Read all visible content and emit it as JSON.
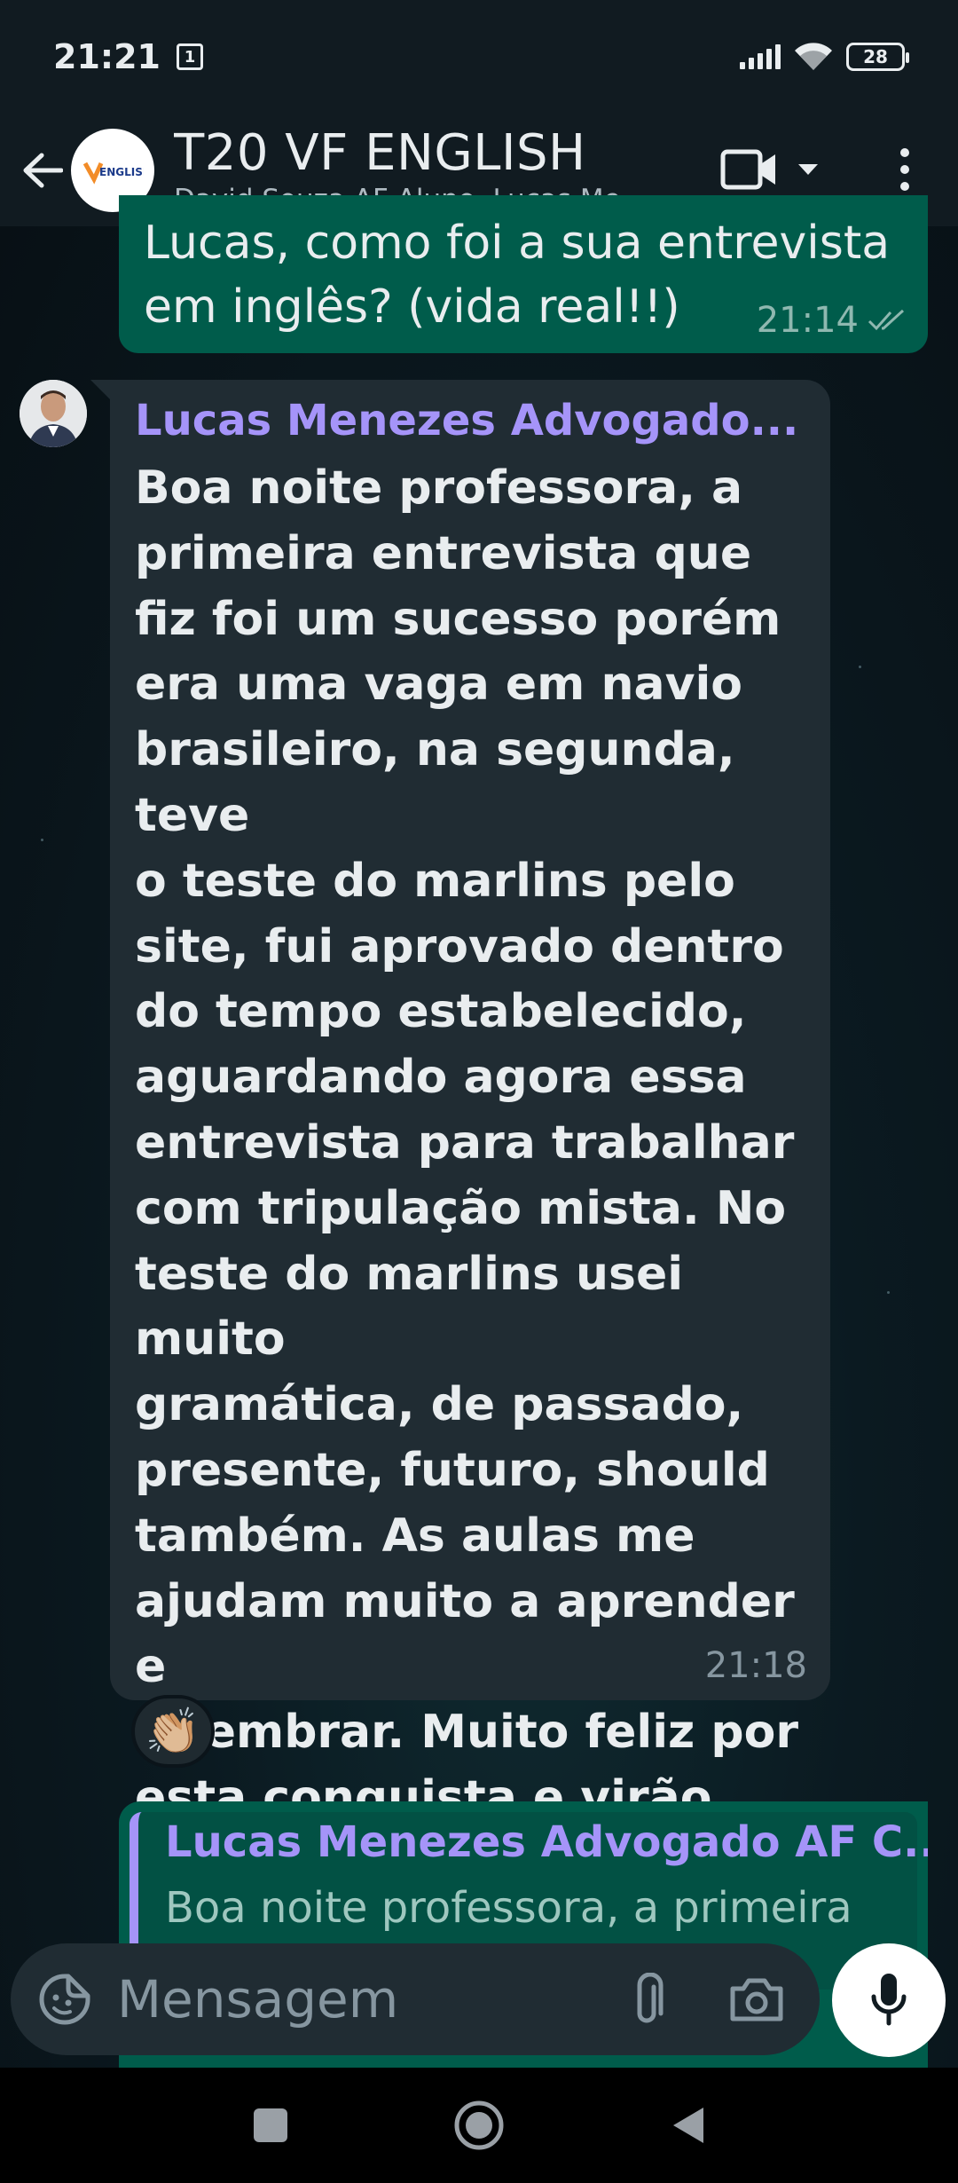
{
  "status_bar": {
    "time": "21:21",
    "sim_badge": "1",
    "battery": "28"
  },
  "header": {
    "title": "T20 VF ENGLISH",
    "subtitle": "David Souza AF Aluno, Lucas Me...",
    "avatar_logo_text": "ENGLISH"
  },
  "messages": {
    "outgoing_top": {
      "text_line1": "Lucas, como foi a sua entrevista",
      "text_line2": "em inglês? (vida real!!)",
      "time": "21:14"
    },
    "incoming": {
      "sender": "Lucas Menezes Advogado...",
      "lines": [
        "Boa noite professora, a",
        "primeira entrevista que",
        "fiz foi um sucesso porém",
        "era uma vaga em navio",
        "brasileiro, na segunda, teve",
        "o teste do marlins pelo",
        "site, fui aprovado dentro",
        "do tempo estabelecido,",
        "aguardando agora essa",
        "entrevista para trabalhar",
        "com tripulação mista. No",
        "teste do marlins usei muito",
        "gramática, de passado,",
        "presente, futuro, should",
        "também. As aulas me",
        "ajudam muito a aprender e",
        "relembrar. Muito feliz por",
        "esta conquista e virão mais."
      ],
      "time": "21:18",
      "reaction": "👏🏼"
    },
    "reply": {
      "quoted_name": "Lucas Menezes Advogado AF C...",
      "quoted_text": "Boa noite professora, a primeira"
    }
  },
  "input": {
    "placeholder": "Mensagem"
  },
  "colors": {
    "outgoing_bubble": "#005c4b",
    "incoming_bubble": "#202c33",
    "sender_name": "#a594f9",
    "header_bg": "#111b21"
  },
  "icons": {
    "back": "arrow-left-icon",
    "video": "video-camera-icon",
    "dropdown": "chevron-down-icon",
    "menu": "more-vertical-icon",
    "emoji": "sticker-smile-icon",
    "attach": "paperclip-icon",
    "camera": "camera-icon",
    "mic": "microphone-icon",
    "read": "double-check-icon",
    "nav_recents": "square-icon",
    "nav_home": "circle-icon",
    "nav_back": "triangle-back-icon"
  }
}
